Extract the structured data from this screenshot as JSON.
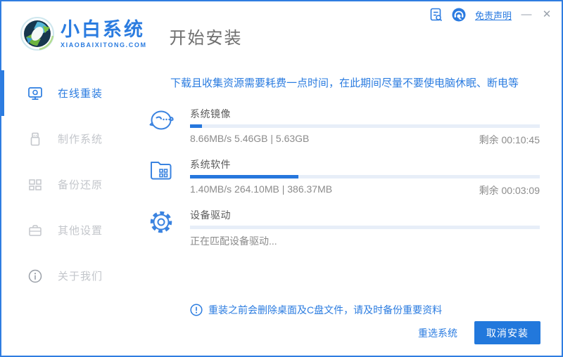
{
  "header": {
    "logo_title": "小白系统",
    "logo_subtitle": "XIAOBAIXITONG.COM",
    "page_title": "开始安装",
    "disclaimer_link": "免责声明",
    "minimize_label": "—",
    "close_label": "✕"
  },
  "sidebar": {
    "items": [
      {
        "label": "在线重装",
        "icon": "monitor-icon",
        "active": true
      },
      {
        "label": "制作系统",
        "icon": "usb-icon",
        "active": false
      },
      {
        "label": "备份还原",
        "icon": "backup-grid-icon",
        "active": false
      },
      {
        "label": "其他设置",
        "icon": "briefcase-icon",
        "active": false
      },
      {
        "label": "关于我们",
        "icon": "info-icon",
        "active": false
      }
    ]
  },
  "main": {
    "notice": "下载且收集资源需要耗费一点时间，在此期间尽量不要使电脑休眠、断电等",
    "tasks": [
      {
        "name": "系统镜像",
        "icon": "mascot-face-icon",
        "progress_percent": 3.5,
        "stats": "8.66MB/s 5.46GB | 5.63GB",
        "remaining": "剩余 00:10:45"
      },
      {
        "name": "系统软件",
        "icon": "app-folder-icon",
        "progress_percent": 31,
        "stats": "1.40MB/s 264.10MB | 386.37MB",
        "remaining": "剩余 00:03:09"
      },
      {
        "name": "设备驱动",
        "icon": "gear-icon",
        "progress_percent": 0,
        "stats": "正在匹配设备驱动...",
        "remaining": ""
      }
    ],
    "warning": "重装之前会删除桌面及C盘文件，请及时备份重要资料"
  },
  "footer": {
    "reselect_label": "重选系统",
    "cancel_label": "取消安装"
  },
  "colors": {
    "accent": "#2b7ce0",
    "button_blue": "#2278dc",
    "progress_track": "#e7eef8",
    "progress_fill": "#2677dd",
    "window_border": "#2f7de1",
    "inactive_gray": "#c3c6cb"
  }
}
